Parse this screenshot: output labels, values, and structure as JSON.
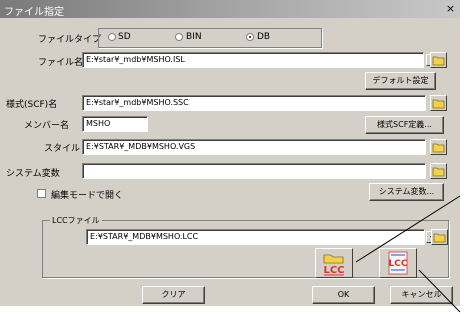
{
  "window": {
    "title": "ファイル指定",
    "close_glyph": "×"
  },
  "filetype": {
    "label": "ファイルタイプ",
    "options": [
      "SD",
      "BIN",
      "DB"
    ],
    "selected": "DB"
  },
  "file": {
    "label": "ファイル名",
    "value": "E:¥star¥_mdb¥MSHO.ISL",
    "default_button": "デフォルト設定"
  },
  "scf": {
    "label": "様式(SCF)名",
    "value": "E:¥star¥_mdb¥MSHO.SSC"
  },
  "member": {
    "label": "メンバー名",
    "value": "MSHO",
    "define_button": "様式SCF定義..."
  },
  "style": {
    "label": "スタイル",
    "value": "E:¥STAR¥_MDB¥MSHO.VGS"
  },
  "sysvar": {
    "label": "システム変数",
    "value": "",
    "button": "システム変数..."
  },
  "editmode": {
    "label": "編集モードで開く",
    "checked": false
  },
  "lcc": {
    "group_label": "LCCファイル",
    "value": "E:¥STAR¥_MDB¥MSHO.LCC",
    "open_icon_text": "LCC",
    "edit_icon_text": "LCC"
  },
  "buttons": {
    "clear": "クリア",
    "ok": "OK",
    "cancel": "キャンセル"
  },
  "colors": {
    "lcc_red": "#e0302a",
    "folder_yellow": "#f2d24a",
    "title_gray": "#8a8a8a"
  }
}
